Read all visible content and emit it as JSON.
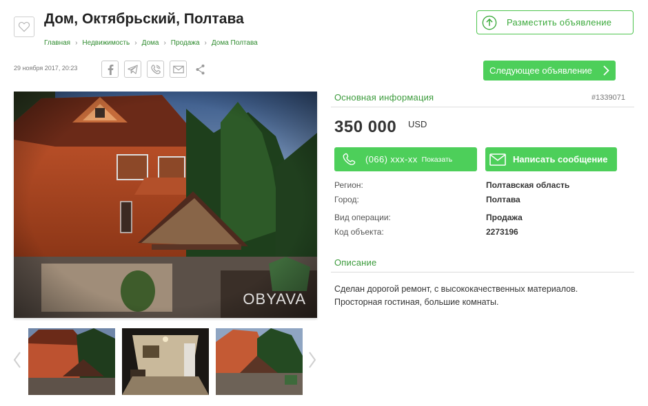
{
  "header": {
    "title": "Дом, Октябрьский, Полтава",
    "breadcrumbs": [
      "Главная",
      "Недвижимость",
      "Дома",
      "Продажа",
      "Дома Полтава"
    ],
    "post_button": "Разместить объявление"
  },
  "meta": {
    "date": "29 ноября 2017, 20:23",
    "share_icons": [
      "facebook-icon",
      "telegram-icon",
      "viber-icon",
      "email-icon",
      "share-icon"
    ],
    "next_button": "Следующее объявление"
  },
  "gallery": {
    "watermark": "OBYAVA",
    "thumbnails": [
      "house-exterior",
      "living-room-interior",
      "house-garden"
    ]
  },
  "info": {
    "section_title": "Основная информация",
    "ad_number": "#1339071",
    "price": "350 000",
    "currency": "USD",
    "phone": "(066) xxx-xx",
    "show_label": "Показать",
    "message_button": "Написать сообщение",
    "fields": [
      {
        "label": "Регион:",
        "value": "Полтавская область"
      },
      {
        "label": "Город:",
        "value": "Полтава"
      },
      {
        "label": "Вид операции:",
        "value": "Продажа"
      },
      {
        "label": "Код объекта:",
        "value": "2273196"
      }
    ]
  },
  "description": {
    "section_title": "Описание",
    "text_line1": "Сделан дорогой ремонт, с высококачественных материалов.",
    "text_line2": "Просторная гостиная, большие комнаты."
  },
  "colors": {
    "accent_green": "#4dcf5a",
    "link_green": "#2e8b2e",
    "section_green": "#3a9a3a"
  }
}
